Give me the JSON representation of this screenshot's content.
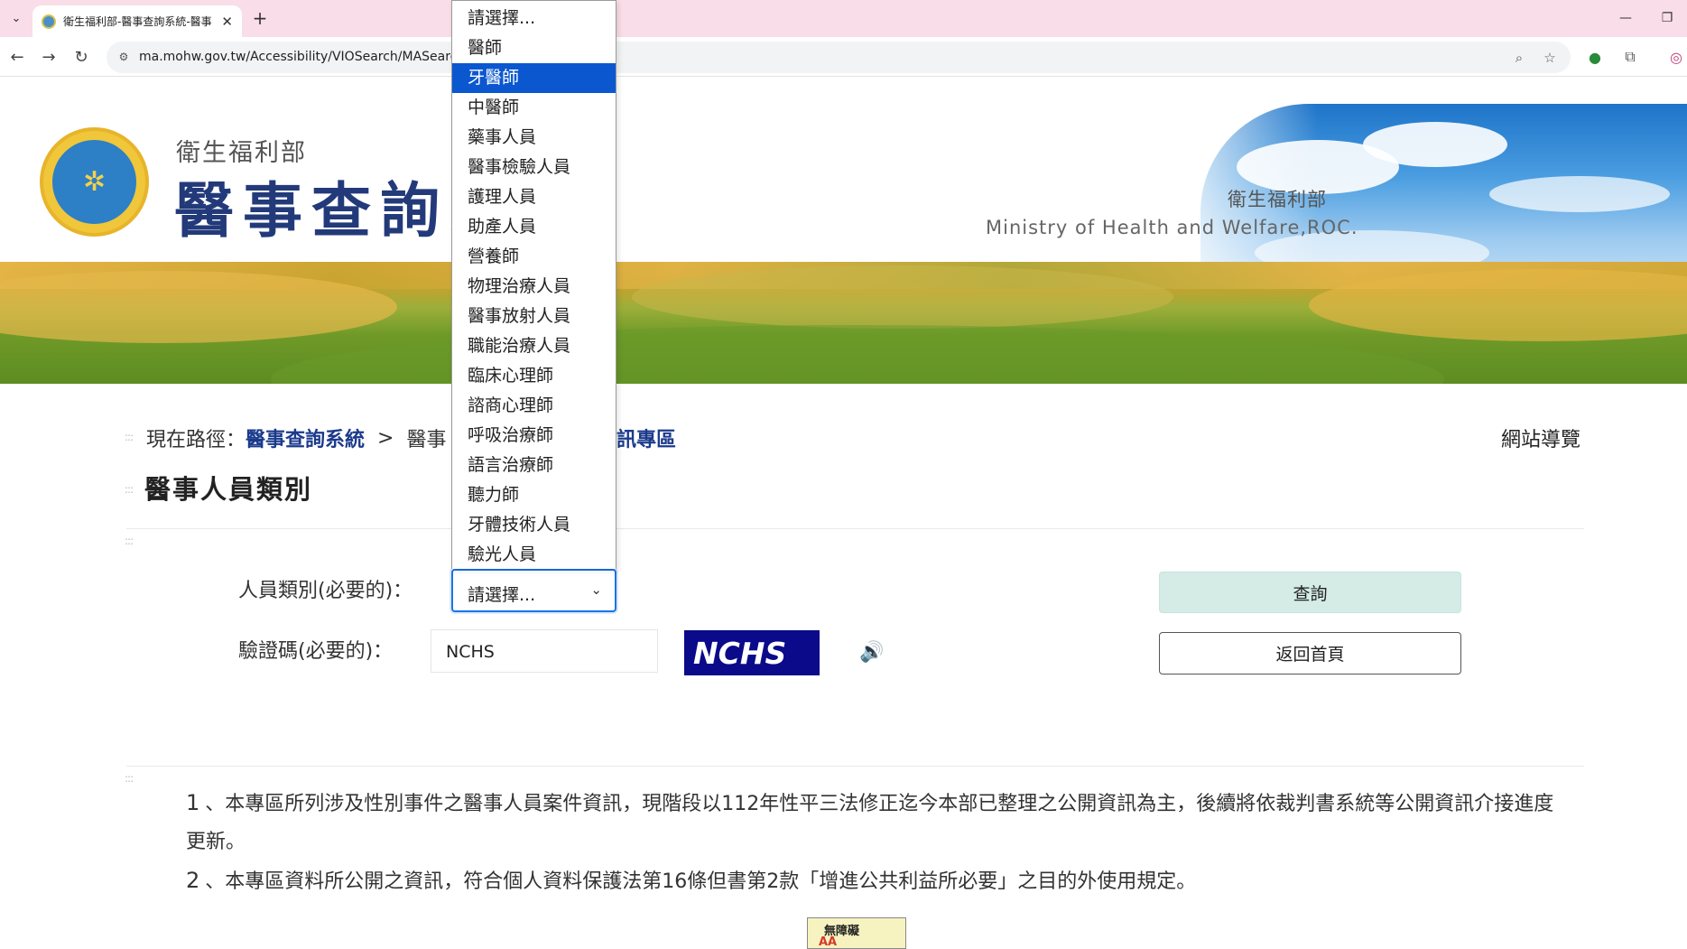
{
  "browser": {
    "tab_title": "衛生福利部-醫事查詢系統-醫事",
    "url": "ma.mohw.gov.tw/Accessibility/VIOSearch/MASearch"
  },
  "header": {
    "dept_name": "衛生福利部",
    "system_name": "醫事查詢系",
    "ministry_zh": "衛生福利部",
    "ministry_en": "Ministry of Health and Welfare,ROC."
  },
  "breadcrumb": {
    "prefix": "現在路徑：",
    "home_link": "醫事查詢系統",
    "separator": ">",
    "current_partial_left": "醫事",
    "current_partial_right": "訊專區"
  },
  "site_nav_label": "網站導覽",
  "page_title": "醫事人員類別",
  "form": {
    "category_label": "人員類別(必要的)：",
    "category_selected": "請選擇...",
    "captcha_label": "驗證碼(必要的)：",
    "captcha_value": "NCHS",
    "captcha_image_text": "NCHS",
    "query_button": "查詢",
    "home_button": "返回首頁"
  },
  "dropdown": {
    "options": [
      "請選擇...",
      "醫師",
      "牙醫師",
      "中醫師",
      "藥事人員",
      "醫事檢驗人員",
      "護理人員",
      "助產人員",
      "營養師",
      "物理治療人員",
      "醫事放射人員",
      "職能治療人員",
      "臨床心理師",
      "諮商心理師",
      "呼吸治療師",
      "語言治療師",
      "聽力師",
      "牙體技術人員",
      "驗光人員"
    ],
    "highlighted": "牙醫師"
  },
  "notices": [
    {
      "num": "1",
      "text": "、本專區所列涉及性別事件之醫事人員案件資訊，現階段以112年性平三法修正迄今本部已整理之公開資訊為主，後續將依裁判書系統等公開資訊介接進度更新。"
    },
    {
      "num": "2",
      "text": "、本專區資料所公開之資訊，符合個人資料保護法第16條但書第2款「增進公共利益所必要」之目的外使用規定。"
    }
  ],
  "badge": {
    "line1": "無障礙",
    "line2": "AA"
  },
  "colors": {
    "tabbar_bg": "#f9dde8",
    "link_blue": "#1b3a8c",
    "highlight": "#0b57d0",
    "query_btn_bg": "#d4ebe6",
    "captcha_bg": "#0a0a8a"
  }
}
